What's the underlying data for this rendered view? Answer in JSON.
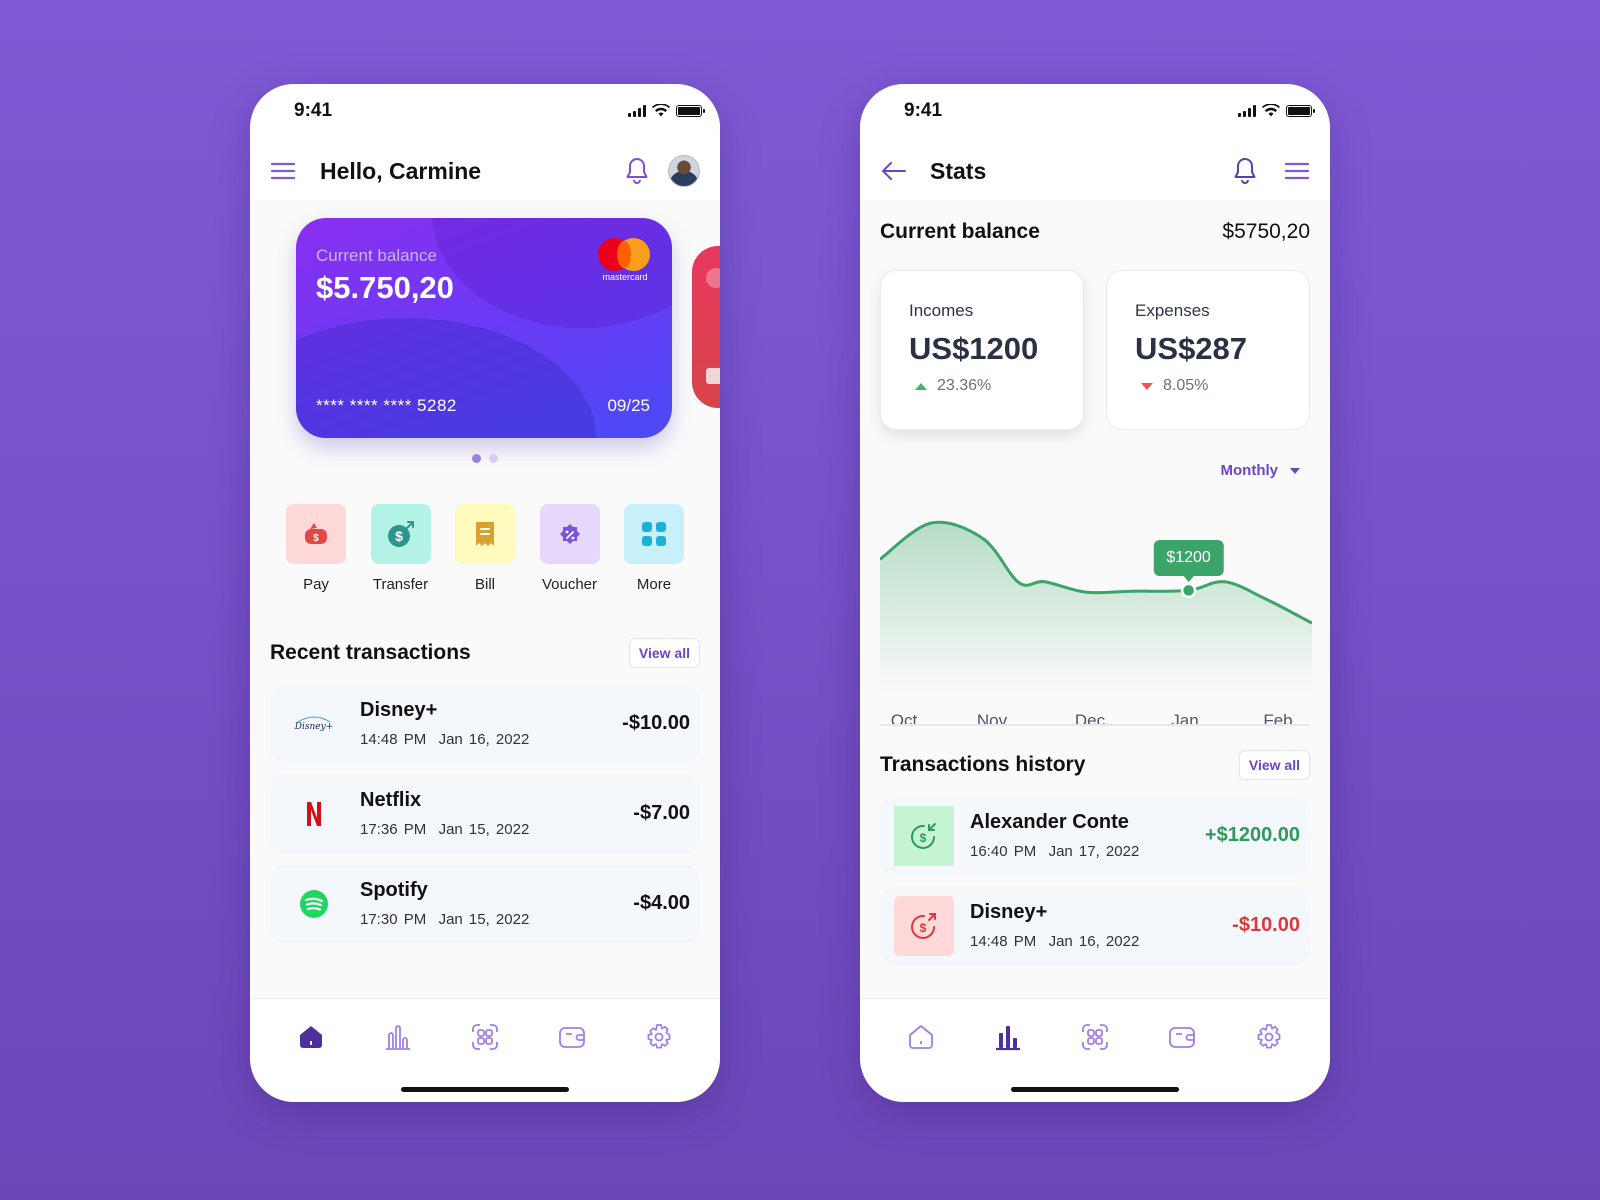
{
  "home": {
    "status": {
      "time": "9:41"
    },
    "header": {
      "greeting": "Hello, Carmine"
    },
    "card": {
      "label": "Current balance",
      "balance": "$5.750,20",
      "number": "**** **** **** 5282",
      "expiry": "09/25",
      "brand": "mastercard"
    },
    "carousel": {
      "pages": 2,
      "active": 0
    },
    "quick_actions": [
      {
        "label": "Pay",
        "icon": "wallet-dollar-icon",
        "bg": "#ffd9d9",
        "fg": "#e24848"
      },
      {
        "label": "Transfer",
        "icon": "dollar-send-icon",
        "bg": "#b3f3e6",
        "fg": "#2e9588"
      },
      {
        "label": "Bill",
        "icon": "receipt-icon",
        "bg": "#fffbbf",
        "fg": "#d9a22e"
      },
      {
        "label": "Voucher",
        "icon": "discount-badge-icon",
        "bg": "#e6d8fd",
        "fg": "#7b55d8"
      },
      {
        "label": "More",
        "icon": "grid-icon",
        "bg": "#c8f0fa",
        "fg": "#1cb2d8"
      }
    ],
    "recent": {
      "title": "Recent transactions",
      "view_all": "View all",
      "items": [
        {
          "name": "Disney+",
          "time": "14:48 PM",
          "date": "Jan 16, 2022",
          "amount": "-$10.00",
          "logo": "disney-plus-logo"
        },
        {
          "name": "Netflix",
          "time": "17:36 PM",
          "date": "Jan 15, 2022",
          "amount": "-$7.00",
          "logo": "netflix-logo"
        },
        {
          "name": "Spotify",
          "time": "17:30 PM",
          "date": "Jan 15, 2022",
          "amount": "-$4.00",
          "logo": "spotify-logo"
        }
      ]
    },
    "nav": {
      "active": "home"
    }
  },
  "stats": {
    "status": {
      "time": "9:41"
    },
    "header": {
      "title": "Stats"
    },
    "current_balance": {
      "label": "Current balance",
      "value": "$5750,20"
    },
    "incomes": {
      "label": "Incomes",
      "value": "US$1200",
      "change": "23.36%",
      "direction": "up"
    },
    "expenses": {
      "label": "Expenses",
      "value": "US$287",
      "change": "8.05%",
      "direction": "down"
    },
    "period": {
      "selected": "Monthly"
    },
    "history": {
      "title": "Transactions history",
      "view_all": "View all",
      "items": [
        {
          "name": "Alexander Conte",
          "time": "16:40 PM",
          "date": "Jan 17, 2022",
          "amount": "+$1200.00",
          "type": "income"
        },
        {
          "name": "Disney+",
          "time": "14:48 PM",
          "date": "Jan 16, 2022",
          "amount": "-$10.00",
          "type": "expense"
        }
      ]
    },
    "nav": {
      "active": "stats"
    }
  },
  "colors": {
    "accent": "#6a45c9",
    "nav_active": "#4f2f9c",
    "nav_inactive": "#a07de8",
    "chart_line": "#3ba468",
    "income": "#2e9a5c",
    "expense": "#d93a3a"
  },
  "chart_data": {
    "type": "area",
    "title": "",
    "xlabel": "",
    "ylabel": "",
    "categories": [
      "Oct",
      "Nov",
      "Dec",
      "Jan",
      "Feb"
    ],
    "x": [
      0,
      0.5,
      1,
      1.35,
      1.6,
      2,
      2.45,
      3,
      3.35,
      3.75,
      4.2
    ],
    "values": [
      1560,
      1980,
      1800,
      1290,
      1300,
      1180,
      1190,
      1200,
      1300,
      1100,
      820
    ],
    "ylim": [
      0,
      2200
    ],
    "highlight": {
      "category": "Jan",
      "label": "$1200",
      "value": 1200
    },
    "grid": false,
    "legend": "none"
  }
}
